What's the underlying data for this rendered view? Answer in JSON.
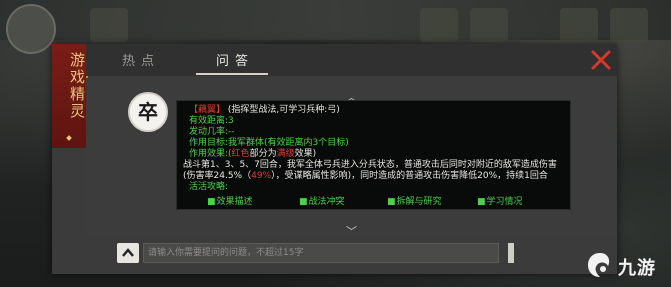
{
  "side_tab": {
    "label": "游戏精灵"
  },
  "tabs": [
    {
      "label": "热点",
      "active": false
    },
    {
      "label": "问答",
      "active": true
    }
  ],
  "answer": {
    "title": "【藕翼】",
    "title_desc": "(指挥型战法,可学习兵种:弓)",
    "effective_distance": "有效距离:3",
    "trigger_rate": "发动几率:--",
    "target": "作用目标:我军群体(有效距离内3个目标)",
    "effect_prefix": "作用效果:(",
    "effect_red": "红色",
    "effect_mid": "部分为",
    "effect_red2": "满级",
    "effect_suffix": "效果)",
    "body1": "战斗第1、3、5、7回合，我军全体弓兵进入分兵状态，普通攻击后同时对附近的敌军造成伤害",
    "body2_prefix": "(伤害率24.5%（",
    "body2_red": "49%",
    "body2_suffix": "），受谋略属性影响)，同时造成的普通攻击伤害降低20%，持续1回合",
    "strategy": "活活攻略:",
    "links": [
      "效果描述",
      "战法冲突",
      "拆解与研究",
      "学习情况"
    ]
  },
  "input": {
    "placeholder": "请输入你需要提问的问题，不超过15字"
  },
  "watermark": {
    "text": "九游"
  },
  "colors": {
    "accent_red": "#e43b34",
    "accent_green": "#4bd14b",
    "gold": "#e7c677"
  },
  "icons": {
    "avatar": "卒"
  }
}
